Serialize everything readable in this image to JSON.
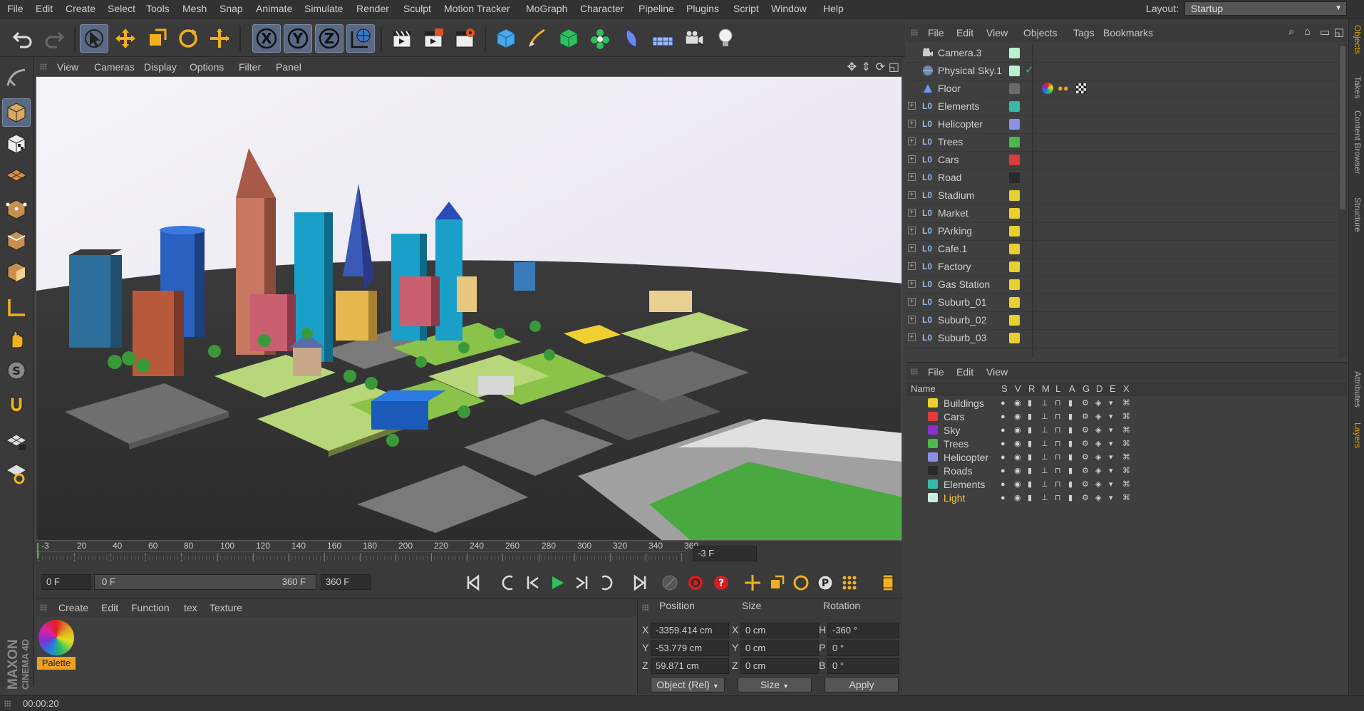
{
  "menubar": {
    "items": [
      "File",
      "Edit",
      "Create",
      "Select",
      "Tools",
      "Mesh",
      "Snap",
      "Animate",
      "Simulate",
      "Sculpt",
      "Motion Tracker",
      "MoGraph",
      "Character",
      "Pipeline",
      "Plugins",
      "Script",
      "Window",
      "Help"
    ],
    "layout_label": "Layout:",
    "layout_value": "Startup"
  },
  "viewport": {
    "menu": [
      "View",
      "Cameras",
      "Display",
      "Options",
      "Filter",
      "Panel"
    ]
  },
  "timeline": {
    "ticks": [
      "-3",
      "20",
      "40",
      "60",
      "80",
      "100",
      "120",
      "140",
      "160",
      "180",
      "200",
      "220",
      "240",
      "260",
      "280",
      "300",
      "320",
      "340",
      "360"
    ],
    "current_frame": "-3 F"
  },
  "playbar": {
    "start_frame": "0 F",
    "range_start": "0 F",
    "range_end": "360 F",
    "end_frame": "360 F"
  },
  "material_manager": {
    "menu": [
      "Create",
      "Edit",
      "Function",
      "tex",
      "Texture"
    ],
    "materials": [
      {
        "name": "Palette"
      }
    ]
  },
  "coordinates": {
    "headers": [
      "Position",
      "Size",
      "Rotation"
    ],
    "position": {
      "x": "-3359.414 cm",
      "y": "-53.779 cm",
      "z": "59.871 cm"
    },
    "size": {
      "x": "0 cm",
      "y": "0 cm",
      "z": "0 cm"
    },
    "rotation": {
      "h": "-360 °",
      "p": "0 °",
      "b": "0 °"
    },
    "axis_labels": {
      "x": "X",
      "y": "Y",
      "z": "Z",
      "h": "H",
      "p": "P",
      "b": "B"
    },
    "mode": "Object (Rel)",
    "size_mode": "Size",
    "apply": "Apply"
  },
  "status": {
    "time": "00:00:20"
  },
  "object_manager": {
    "menu": [
      "File",
      "Edit",
      "View",
      "Objects",
      "Tags",
      "Bookmarks"
    ],
    "objects": [
      {
        "name": "Camera.3",
        "color": "#b8f0d0",
        "icon": "camera-icon"
      },
      {
        "name": "Physical Sky.1",
        "color": "#b8f0d0",
        "icon": "sky-icon"
      },
      {
        "name": "Floor",
        "color": "#6a6a6a",
        "icon": "floor-icon"
      },
      {
        "name": "Elements",
        "color": "#38b8a8",
        "icon": "null-icon"
      },
      {
        "name": "Helicopter",
        "color": "#8a90e8",
        "icon": "null-icon"
      },
      {
        "name": "Trees",
        "color": "#4cb84c",
        "icon": "null-icon"
      },
      {
        "name": "Cars",
        "color": "#e03a3a",
        "icon": "null-icon"
      },
      {
        "name": "Road",
        "color": "#2a2a2a",
        "icon": "null-icon"
      },
      {
        "name": "Stadium",
        "color": "#e8d030",
        "icon": "null-icon"
      },
      {
        "name": "Market",
        "color": "#e8d030",
        "icon": "null-icon"
      },
      {
        "name": "PArking",
        "color": "#e8d030",
        "icon": "null-icon"
      },
      {
        "name": "Cafe.1",
        "color": "#e8d030",
        "icon": "null-icon"
      },
      {
        "name": "Factory",
        "color": "#e8d030",
        "icon": "null-icon"
      },
      {
        "name": "Gas Station",
        "color": "#e8d030",
        "icon": "null-icon"
      },
      {
        "name": "Suburb_01",
        "color": "#e8d030",
        "icon": "null-icon"
      },
      {
        "name": "Suburb_02",
        "color": "#e8d030",
        "icon": "null-icon"
      },
      {
        "name": "Suburb_03",
        "color": "#e8d030",
        "icon": "null-icon"
      }
    ]
  },
  "layer_manager": {
    "menu": [
      "File",
      "Edit",
      "View"
    ],
    "columns": [
      "Name",
      "S",
      "V",
      "R",
      "M",
      "L",
      "A",
      "G",
      "D",
      "E",
      "X"
    ],
    "layers": [
      {
        "name": "Buildings",
        "color": "#e8d030"
      },
      {
        "name": "Cars",
        "color": "#e03a3a"
      },
      {
        "name": "Sky",
        "color": "#8a30d0"
      },
      {
        "name": "Trees",
        "color": "#4cb84c"
      },
      {
        "name": "Helicopter",
        "color": "#8a90e8"
      },
      {
        "name": "Roads",
        "color": "#2a2a2a"
      },
      {
        "name": "Elements",
        "color": "#38b8a8"
      },
      {
        "name": "Light",
        "color": "#c8f0e0",
        "highlight": "#ffcc33"
      }
    ]
  },
  "right_tabs": [
    "Objects",
    "Takes",
    "Content Browser",
    "Structure",
    "Attributes",
    "Layers"
  ],
  "branding": {
    "line1": "MAXON",
    "line2": "CINEMA 4D"
  }
}
